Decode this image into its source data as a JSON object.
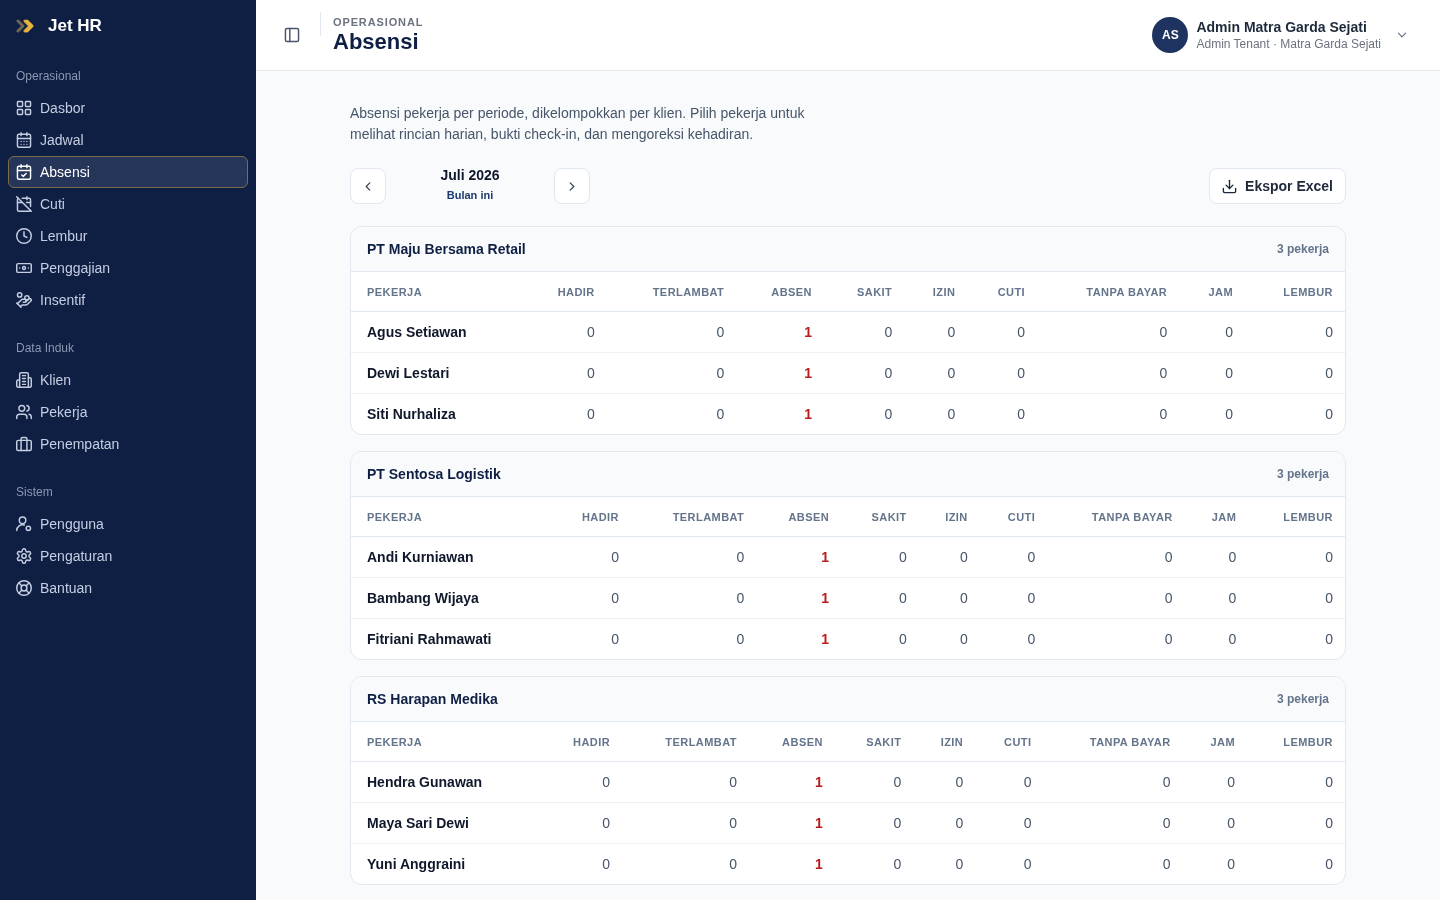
{
  "sidebar": {
    "brand": "Jet HR",
    "sections": [
      {
        "label": "Operasional",
        "items": [
          {
            "label": "Dasbor",
            "selected": false
          },
          {
            "label": "Jadwal",
            "selected": false
          },
          {
            "label": "Absensi",
            "selected": true
          },
          {
            "label": "Cuti",
            "selected": false
          },
          {
            "label": "Lembur",
            "selected": false
          },
          {
            "label": "Penggajian",
            "selected": false
          },
          {
            "label": "Insentif",
            "selected": false
          }
        ]
      },
      {
        "label": "Data Induk",
        "items": [
          {
            "label": "Klien",
            "selected": false
          },
          {
            "label": "Pekerja",
            "selected": false
          },
          {
            "label": "Penempatan",
            "selected": false
          }
        ]
      },
      {
        "label": "Sistem",
        "items": [
          {
            "label": "Pengguna",
            "selected": false
          },
          {
            "label": "Pengaturan",
            "selected": false
          },
          {
            "label": "Bantuan",
            "selected": false
          }
        ]
      }
    ]
  },
  "header": {
    "breadcrumb": "OPERASIONAL",
    "title": "Absensi",
    "user": {
      "initials": "AS",
      "name": "Admin Matra Garda Sejati",
      "subtitle": "Admin Tenant · Matra Garda Sejati"
    }
  },
  "description": "Absensi pekerja per periode, dikelompokkan per klien. Pilih pekerja untuk melihat rincian harian, bukti check-in, dan mengoreksi kehadiran.",
  "period": {
    "label": "Juli 2026",
    "caption": "Bulan ini"
  },
  "export_button": "Ekspor Excel",
  "clients": [
    {
      "name": "PT Maju Bersama Retail",
      "count": "3 pekerja",
      "columns": [
        {
          "label": "PEKERJA",
          "kind": "name"
        },
        {
          "label": "HADIR",
          "kind": "number"
        },
        {
          "label": "TERLAMBAT",
          "kind": "number"
        },
        {
          "label": "ABSEN",
          "kind": "alert"
        },
        {
          "label": "SAKIT",
          "kind": "number"
        },
        {
          "label": "IZIN",
          "kind": "number"
        },
        {
          "label": "CUTI",
          "kind": "number"
        },
        {
          "label": "TANPA BAYAR",
          "kind": "number"
        },
        {
          "label": "JAM",
          "kind": "number"
        },
        {
          "label": "LEMBUR",
          "kind": "number"
        }
      ],
      "rows": [
        {
          "cells": [
            "Agus Setiawan",
            "0",
            "0",
            "1",
            "0",
            "0",
            "0",
            "0",
            "0",
            "0"
          ]
        },
        {
          "cells": [
            "Dewi Lestari",
            "0",
            "0",
            "1",
            "0",
            "0",
            "0",
            "0",
            "0",
            "0"
          ]
        },
        {
          "cells": [
            "Siti Nurhaliza",
            "0",
            "0",
            "1",
            "0",
            "0",
            "0",
            "0",
            "0",
            "0"
          ]
        }
      ]
    },
    {
      "name": "PT Sentosa Logistik",
      "count": "3 pekerja",
      "columns": [
        {
          "label": "PEKERJA",
          "kind": "name"
        },
        {
          "label": "HADIR",
          "kind": "number"
        },
        {
          "label": "TERLAMBAT",
          "kind": "number"
        },
        {
          "label": "ABSEN",
          "kind": "alert"
        },
        {
          "label": "SAKIT",
          "kind": "number"
        },
        {
          "label": "IZIN",
          "kind": "number"
        },
        {
          "label": "CUTI",
          "kind": "number"
        },
        {
          "label": "TANPA BAYAR",
          "kind": "number"
        },
        {
          "label": "JAM",
          "kind": "number"
        },
        {
          "label": "LEMBUR",
          "kind": "number"
        }
      ],
      "rows": [
        {
          "cells": [
            "Andi Kurniawan",
            "0",
            "0",
            "1",
            "0",
            "0",
            "0",
            "0",
            "0",
            "0"
          ]
        },
        {
          "cells": [
            "Bambang Wijaya",
            "0",
            "0",
            "1",
            "0",
            "0",
            "0",
            "0",
            "0",
            "0"
          ]
        },
        {
          "cells": [
            "Fitriani Rahmawati",
            "0",
            "0",
            "1",
            "0",
            "0",
            "0",
            "0",
            "0",
            "0"
          ]
        }
      ]
    },
    {
      "name": "RS Harapan Medika",
      "count": "3 pekerja",
      "columns": [
        {
          "label": "PEKERJA",
          "kind": "name"
        },
        {
          "label": "HADIR",
          "kind": "number"
        },
        {
          "label": "TERLAMBAT",
          "kind": "number"
        },
        {
          "label": "ABSEN",
          "kind": "alert"
        },
        {
          "label": "SAKIT",
          "kind": "number"
        },
        {
          "label": "IZIN",
          "kind": "number"
        },
        {
          "label": "CUTI",
          "kind": "number"
        },
        {
          "label": "TANPA BAYAR",
          "kind": "number"
        },
        {
          "label": "JAM",
          "kind": "number"
        },
        {
          "label": "LEMBUR",
          "kind": "number"
        }
      ],
      "rows": [
        {
          "cells": [
            "Hendra Gunawan",
            "0",
            "0",
            "1",
            "0",
            "0",
            "0",
            "0",
            "0",
            "0"
          ]
        },
        {
          "cells": [
            "Maya Sari Dewi",
            "0",
            "0",
            "1",
            "0",
            "0",
            "0",
            "0",
            "0",
            "0"
          ]
        },
        {
          "cells": [
            "Yuni Anggraini",
            "0",
            "0",
            "1",
            "0",
            "0",
            "0",
            "0",
            "0",
            "0"
          ]
        }
      ]
    }
  ]
}
